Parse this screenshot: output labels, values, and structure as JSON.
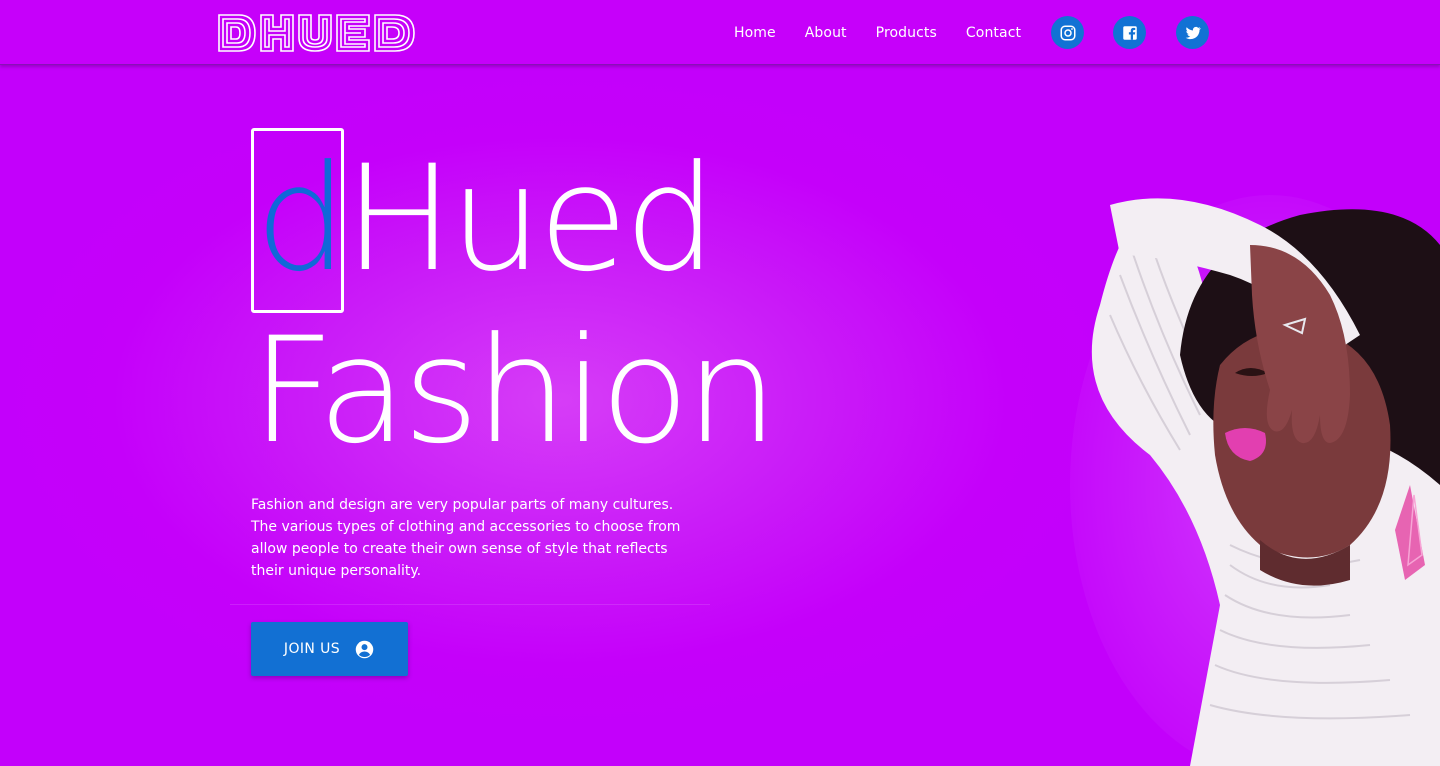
{
  "brand": {
    "logo_text": "DHUED"
  },
  "nav": {
    "links": [
      "Home",
      "About",
      "Products",
      "Contact"
    ],
    "social": [
      {
        "name": "instagram",
        "icon": "instagram-icon"
      },
      {
        "name": "facebook",
        "icon": "facebook-icon"
      },
      {
        "name": "twitter",
        "icon": "twitter-icon"
      }
    ]
  },
  "hero": {
    "title_accent": "d",
    "title_rest": "Hued",
    "title_line2": "Fashion",
    "description": "Fashion and design are very popular parts of many cultures. The various types of clothing and accessories to choose from allow people to create their own sense of style that reflects their unique personality.",
    "cta_label": "JOIN US",
    "cta_icon": "account-circle-icon"
  },
  "colors": {
    "background": "#c600fa",
    "accent_blue": "#1270d3",
    "text": "#ffffff"
  }
}
